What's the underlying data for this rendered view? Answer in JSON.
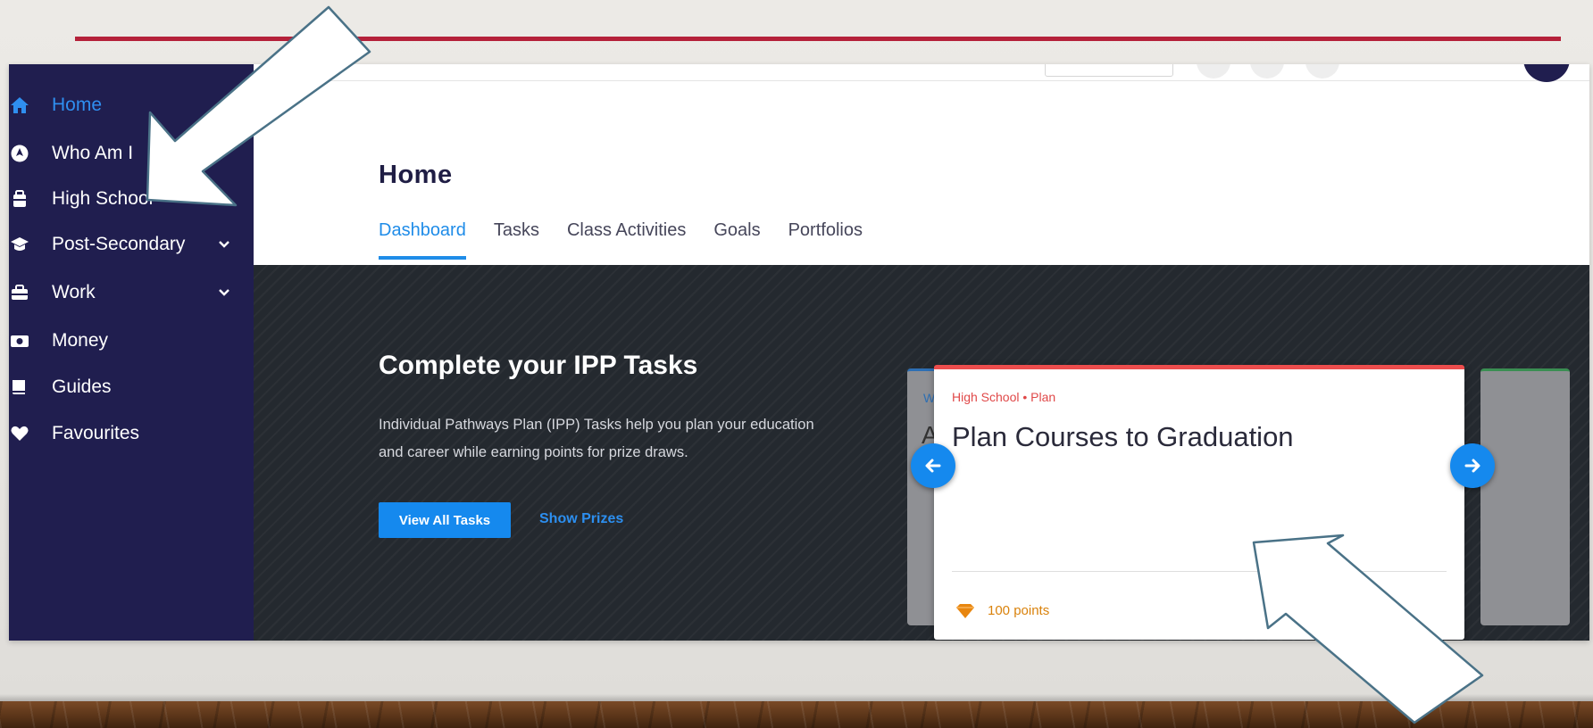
{
  "colors": {
    "sidebar_bg": "#201e4f",
    "accent": "#1589ee",
    "card_accent": "#ec4d4d",
    "points": "#d9820c",
    "banner_bg": "#24292f",
    "slide_rule": "#b5213a"
  },
  "sidebar": {
    "items": [
      {
        "label": "Home",
        "icon": "home-icon",
        "active": true
      },
      {
        "label": "Who Am I",
        "icon": "compass-icon"
      },
      {
        "label": "High School",
        "icon": "school-bag-icon"
      },
      {
        "label": "Post-Secondary",
        "icon": "graduation-cap-icon",
        "expandable": true
      },
      {
        "label": "Work",
        "icon": "briefcase-icon",
        "expandable": true
      },
      {
        "label": "Money",
        "icon": "money-icon"
      },
      {
        "label": "Guides",
        "icon": "book-icon"
      },
      {
        "label": "Favourites",
        "icon": "heart-icon"
      }
    ]
  },
  "header": {
    "title": "Home",
    "tabs": [
      "Dashboard",
      "Tasks",
      "Class Activities",
      "Goals",
      "Portfolios"
    ],
    "active_tab": "Dashboard"
  },
  "banner": {
    "title": "Complete your IPP Tasks",
    "description": "Individual Pathways Plan (IPP) Tasks help you plan your education and career while earning points for prize draws.",
    "primary_button": "View All Tasks",
    "secondary_link": "Show Prizes"
  },
  "carousel": {
    "peek_left_category": "W",
    "peek_left_title": "A",
    "card": {
      "category": "High School • Plan",
      "title": "Plan Courses to Graduation",
      "points": "100 points"
    }
  },
  "annotations": {
    "arrows": [
      "arrow-pointing-sidebar",
      "arrow-pointing-card"
    ]
  }
}
